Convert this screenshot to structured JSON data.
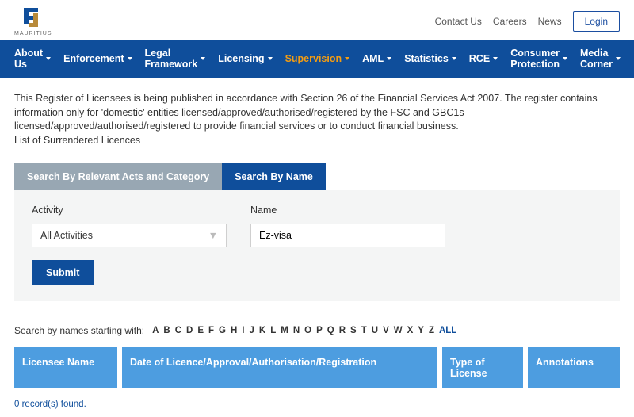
{
  "top": {
    "links": [
      "Contact Us",
      "Careers",
      "News"
    ],
    "login": "Login",
    "logo_sub": "MAURITIUS"
  },
  "nav": [
    {
      "label": "About Us",
      "active": false
    },
    {
      "label": "Enforcement",
      "active": false
    },
    {
      "label": "Legal Framework",
      "active": false
    },
    {
      "label": "Licensing",
      "active": false
    },
    {
      "label": "Supervision",
      "active": true
    },
    {
      "label": "AML",
      "active": false
    },
    {
      "label": "Statistics",
      "active": false
    },
    {
      "label": "RCE",
      "active": false
    },
    {
      "label": "Consumer Protection",
      "active": false
    },
    {
      "label": "Media Corner",
      "active": false
    }
  ],
  "intro": {
    "line1": "This Register of Licensees is being published in accordance with Section 26 of the Financial Services Act 2007. The register contains information only for 'domestic' entities licensed/approved/authorised/registered by the FSC and GBC1s licensed/approved/authorised/registered to provide financial services or to conduct financial business.",
    "surrendered": "List of Surrendered Licences"
  },
  "tabs": {
    "inactive": "Search By Relevant Acts and Category",
    "active": "Search By Name"
  },
  "form": {
    "activity_label": "Activity",
    "activity_value": "All Activities",
    "name_label": "Name",
    "name_value": "Ez-visa",
    "submit": "Submit"
  },
  "alpha": {
    "label": "Search by names starting with:",
    "letters": [
      "A",
      "B",
      "C",
      "D",
      "E",
      "F",
      "G",
      "H",
      "I",
      "J",
      "K",
      "L",
      "M",
      "N",
      "O",
      "P",
      "Q",
      "R",
      "S",
      "T",
      "U",
      "V",
      "W",
      "X",
      "Y",
      "Z"
    ],
    "all": "ALL"
  },
  "table": {
    "h1": "Licensee Name",
    "h2": "Date of Licence/Approval/Authorisation/Registration",
    "h3": "Type of License",
    "h4": "Annotations"
  },
  "records": "0 record(s) found."
}
